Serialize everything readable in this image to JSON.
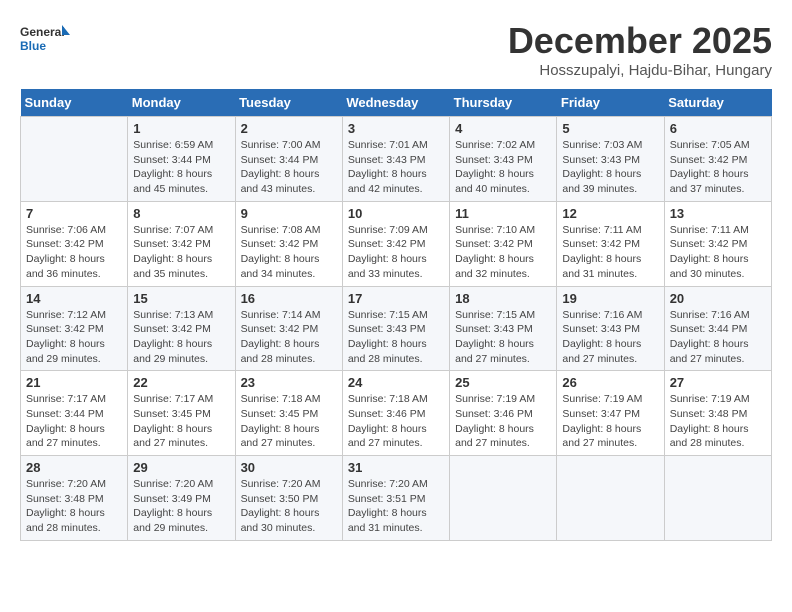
{
  "logo": {
    "line1": "General",
    "line2": "Blue"
  },
  "title": "December 2025",
  "subtitle": "Hosszupalyi, Hajdu-Bihar, Hungary",
  "weekdays": [
    "Sunday",
    "Monday",
    "Tuesday",
    "Wednesday",
    "Thursday",
    "Friday",
    "Saturday"
  ],
  "weeks": [
    [
      {
        "day": "",
        "sunrise": "",
        "sunset": "",
        "daylight": ""
      },
      {
        "day": "1",
        "sunrise": "6:59 AM",
        "sunset": "3:44 PM",
        "daylight": "8 hours and 45 minutes."
      },
      {
        "day": "2",
        "sunrise": "7:00 AM",
        "sunset": "3:44 PM",
        "daylight": "8 hours and 43 minutes."
      },
      {
        "day": "3",
        "sunrise": "7:01 AM",
        "sunset": "3:43 PM",
        "daylight": "8 hours and 42 minutes."
      },
      {
        "day": "4",
        "sunrise": "7:02 AM",
        "sunset": "3:43 PM",
        "daylight": "8 hours and 40 minutes."
      },
      {
        "day": "5",
        "sunrise": "7:03 AM",
        "sunset": "3:43 PM",
        "daylight": "8 hours and 39 minutes."
      },
      {
        "day": "6",
        "sunrise": "7:05 AM",
        "sunset": "3:42 PM",
        "daylight": "8 hours and 37 minutes."
      }
    ],
    [
      {
        "day": "7",
        "sunrise": "7:06 AM",
        "sunset": "3:42 PM",
        "daylight": "8 hours and 36 minutes."
      },
      {
        "day": "8",
        "sunrise": "7:07 AM",
        "sunset": "3:42 PM",
        "daylight": "8 hours and 35 minutes."
      },
      {
        "day": "9",
        "sunrise": "7:08 AM",
        "sunset": "3:42 PM",
        "daylight": "8 hours and 34 minutes."
      },
      {
        "day": "10",
        "sunrise": "7:09 AM",
        "sunset": "3:42 PM",
        "daylight": "8 hours and 33 minutes."
      },
      {
        "day": "11",
        "sunrise": "7:10 AM",
        "sunset": "3:42 PM",
        "daylight": "8 hours and 32 minutes."
      },
      {
        "day": "12",
        "sunrise": "7:11 AM",
        "sunset": "3:42 PM",
        "daylight": "8 hours and 31 minutes."
      },
      {
        "day": "13",
        "sunrise": "7:11 AM",
        "sunset": "3:42 PM",
        "daylight": "8 hours and 30 minutes."
      }
    ],
    [
      {
        "day": "14",
        "sunrise": "7:12 AM",
        "sunset": "3:42 PM",
        "daylight": "8 hours and 29 minutes."
      },
      {
        "day": "15",
        "sunrise": "7:13 AM",
        "sunset": "3:42 PM",
        "daylight": "8 hours and 29 minutes."
      },
      {
        "day": "16",
        "sunrise": "7:14 AM",
        "sunset": "3:42 PM",
        "daylight": "8 hours and 28 minutes."
      },
      {
        "day": "17",
        "sunrise": "7:15 AM",
        "sunset": "3:43 PM",
        "daylight": "8 hours and 28 minutes."
      },
      {
        "day": "18",
        "sunrise": "7:15 AM",
        "sunset": "3:43 PM",
        "daylight": "8 hours and 27 minutes."
      },
      {
        "day": "19",
        "sunrise": "7:16 AM",
        "sunset": "3:43 PM",
        "daylight": "8 hours and 27 minutes."
      },
      {
        "day": "20",
        "sunrise": "7:16 AM",
        "sunset": "3:44 PM",
        "daylight": "8 hours and 27 minutes."
      }
    ],
    [
      {
        "day": "21",
        "sunrise": "7:17 AM",
        "sunset": "3:44 PM",
        "daylight": "8 hours and 27 minutes."
      },
      {
        "day": "22",
        "sunrise": "7:17 AM",
        "sunset": "3:45 PM",
        "daylight": "8 hours and 27 minutes."
      },
      {
        "day": "23",
        "sunrise": "7:18 AM",
        "sunset": "3:45 PM",
        "daylight": "8 hours and 27 minutes."
      },
      {
        "day": "24",
        "sunrise": "7:18 AM",
        "sunset": "3:46 PM",
        "daylight": "8 hours and 27 minutes."
      },
      {
        "day": "25",
        "sunrise": "7:19 AM",
        "sunset": "3:46 PM",
        "daylight": "8 hours and 27 minutes."
      },
      {
        "day": "26",
        "sunrise": "7:19 AM",
        "sunset": "3:47 PM",
        "daylight": "8 hours and 27 minutes."
      },
      {
        "day": "27",
        "sunrise": "7:19 AM",
        "sunset": "3:48 PM",
        "daylight": "8 hours and 28 minutes."
      }
    ],
    [
      {
        "day": "28",
        "sunrise": "7:20 AM",
        "sunset": "3:48 PM",
        "daylight": "8 hours and 28 minutes."
      },
      {
        "day": "29",
        "sunrise": "7:20 AM",
        "sunset": "3:49 PM",
        "daylight": "8 hours and 29 minutes."
      },
      {
        "day": "30",
        "sunrise": "7:20 AM",
        "sunset": "3:50 PM",
        "daylight": "8 hours and 30 minutes."
      },
      {
        "day": "31",
        "sunrise": "7:20 AM",
        "sunset": "3:51 PM",
        "daylight": "8 hours and 31 minutes."
      },
      {
        "day": "",
        "sunrise": "",
        "sunset": "",
        "daylight": ""
      },
      {
        "day": "",
        "sunrise": "",
        "sunset": "",
        "daylight": ""
      },
      {
        "day": "",
        "sunrise": "",
        "sunset": "",
        "daylight": ""
      }
    ]
  ]
}
